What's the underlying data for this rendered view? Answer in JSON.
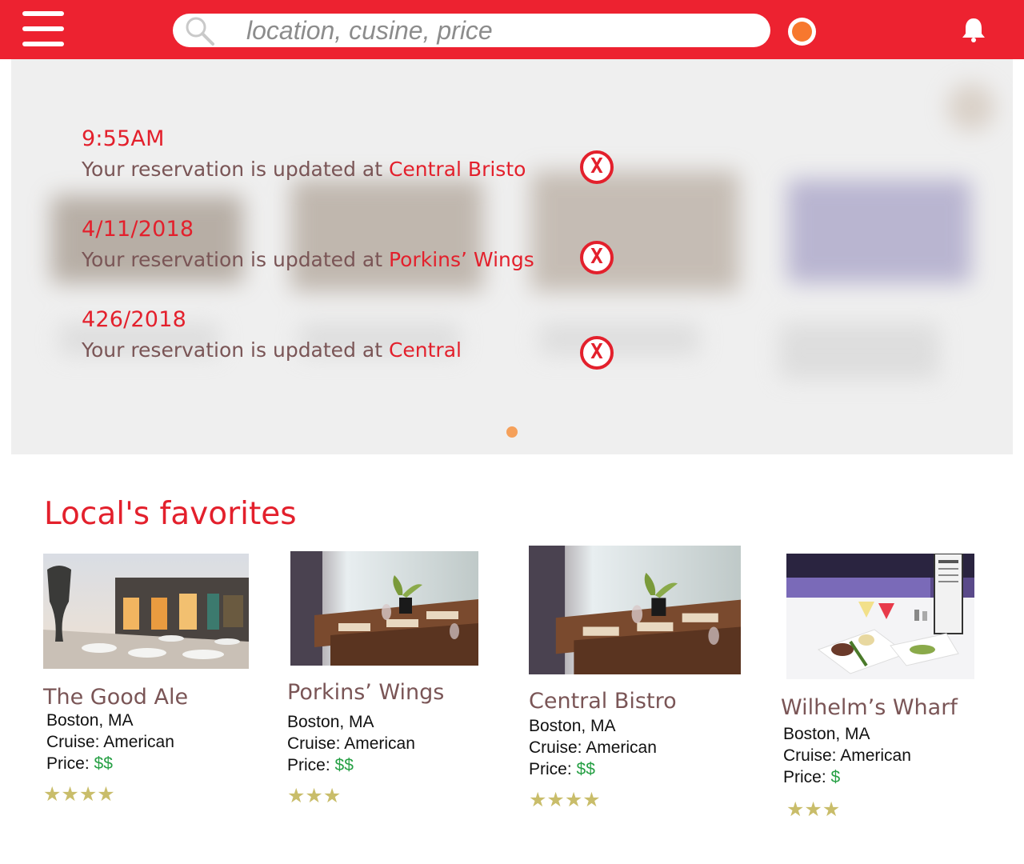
{
  "header": {
    "menu_icon": "hamburger-menu-icon",
    "search_icon": "search-icon",
    "search_placeholder": "location, cusine, price",
    "bell_icon": "bell-icon",
    "accent": "#ed2230",
    "status_dot_color": "#f7782e"
  },
  "notifications": [
    {
      "time": "9:55AM",
      "message": "Your reservation is updated at ",
      "place": "Central Bristo",
      "close_label": "X"
    },
    {
      "time": "4/11/2018",
      "message": "Your reservation is updated at ",
      "place": "Porkins’ Wings",
      "close_label": "X"
    },
    {
      "time": "426/2018",
      "message": "Your reservation is updated at ",
      "place": "Central",
      "close_label": "X"
    }
  ],
  "favorites": {
    "title": "Local's favorites",
    "cards": [
      {
        "name": "The Good Ale",
        "location": "Boston, MA",
        "cuisine_label": "Cruise: American",
        "price_label": "Price: ",
        "price": "$$",
        "rating": 4,
        "stars": "★★★★"
      },
      {
        "name": "Porkins’ Wings",
        "location": "Boston, MA",
        "cuisine_label": "Cruise: American",
        "price_label": "Price: ",
        "price": "$$",
        "rating": 3,
        "stars": "★★★"
      },
      {
        "name": "Central Bistro",
        "location": "Boston, MA",
        "cuisine_label": "Cruise: American",
        "price_label": "Price: ",
        "price": "$$",
        "rating": 4,
        "stars": "★★★★"
      },
      {
        "name": "Wilhelm’s Wharf",
        "location": "Boston, MA",
        "cuisine_label": "Cruise: American",
        "price_label": "Price: ",
        "price": "$",
        "rating": 3,
        "stars": "★★★"
      }
    ]
  }
}
